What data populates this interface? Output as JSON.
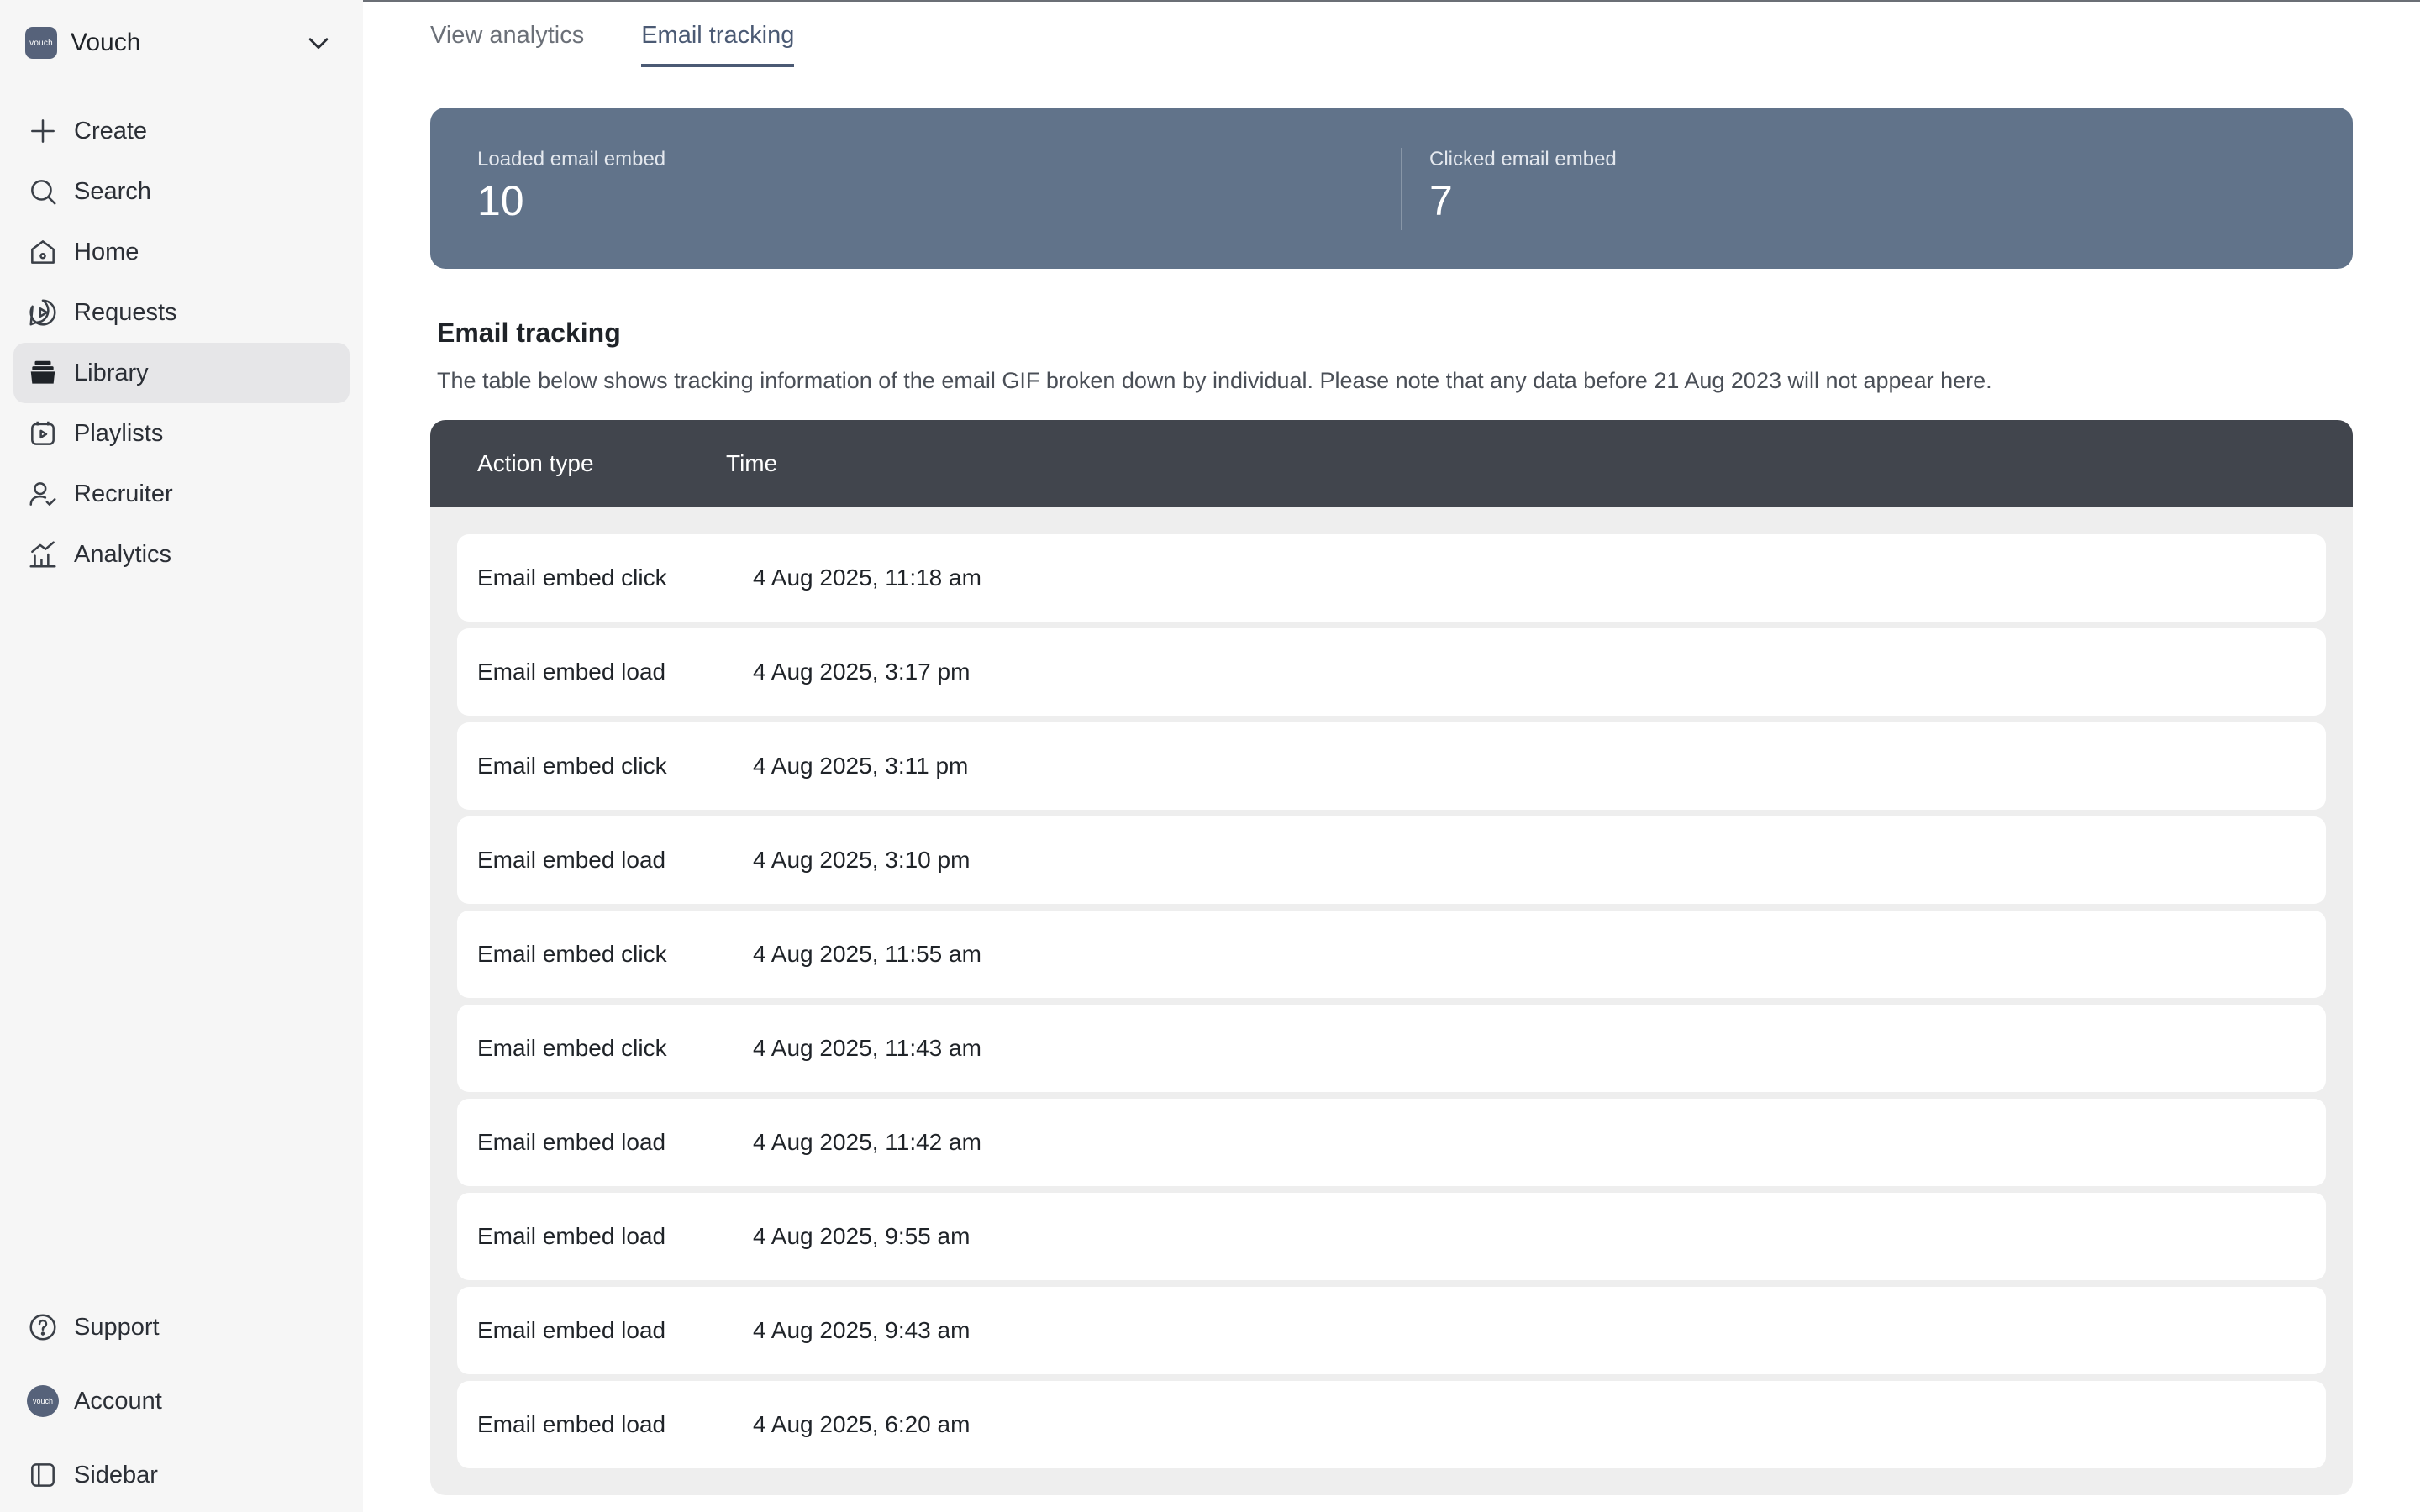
{
  "sidebar": {
    "workspace": {
      "logo_text": "vouch",
      "name": "Vouch"
    },
    "nav": [
      {
        "id": "create",
        "label": "Create"
      },
      {
        "id": "search",
        "label": "Search"
      },
      {
        "id": "home",
        "label": "Home"
      },
      {
        "id": "requests",
        "label": "Requests"
      },
      {
        "id": "library",
        "label": "Library",
        "active": true
      },
      {
        "id": "playlists",
        "label": "Playlists"
      },
      {
        "id": "recruiter",
        "label": "Recruiter"
      },
      {
        "id": "analytics",
        "label": "Analytics"
      }
    ],
    "bottom": {
      "support": "Support",
      "account": "Account",
      "account_avatar_text": "vouch",
      "sidebar": "Sidebar"
    }
  },
  "tabs": {
    "view_analytics": "View analytics",
    "email_tracking": "Email tracking",
    "active": "email_tracking"
  },
  "stats": {
    "loaded": {
      "label": "Loaded email embed",
      "value": "10"
    },
    "clicked": {
      "label": "Clicked email embed",
      "value": "7"
    }
  },
  "section": {
    "title": "Email tracking",
    "description": "The table below shows tracking information of the email GIF broken down by individual. Please note that any data before 21 Aug 2023 will not appear here."
  },
  "table": {
    "headers": {
      "action": "Action type",
      "time": "Time"
    },
    "rows": [
      {
        "action": "Email embed click",
        "time": "4 Aug 2025, 11:18 am"
      },
      {
        "action": "Email embed load",
        "time": "4 Aug 2025, 3:17 pm"
      },
      {
        "action": "Email embed click",
        "time": "4 Aug 2025, 3:11 pm"
      },
      {
        "action": "Email embed load",
        "time": "4 Aug 2025, 3:10 pm"
      },
      {
        "action": "Email embed click",
        "time": "4 Aug 2025, 11:55 am"
      },
      {
        "action": "Email embed click",
        "time": "4 Aug 2025, 11:43 am"
      },
      {
        "action": "Email embed load",
        "time": "4 Aug 2025, 11:42 am"
      },
      {
        "action": "Email embed load",
        "time": "4 Aug 2025, 9:55 am"
      },
      {
        "action": "Email embed load",
        "time": "4 Aug 2025, 9:43 am"
      },
      {
        "action": "Email embed load",
        "time": "4 Aug 2025, 6:20 am"
      }
    ]
  },
  "colors": {
    "sidebar_bg": "#f6f6f6",
    "stats_bg": "#61738a",
    "table_header_bg": "#41454d",
    "accent": "#4b5a74"
  }
}
